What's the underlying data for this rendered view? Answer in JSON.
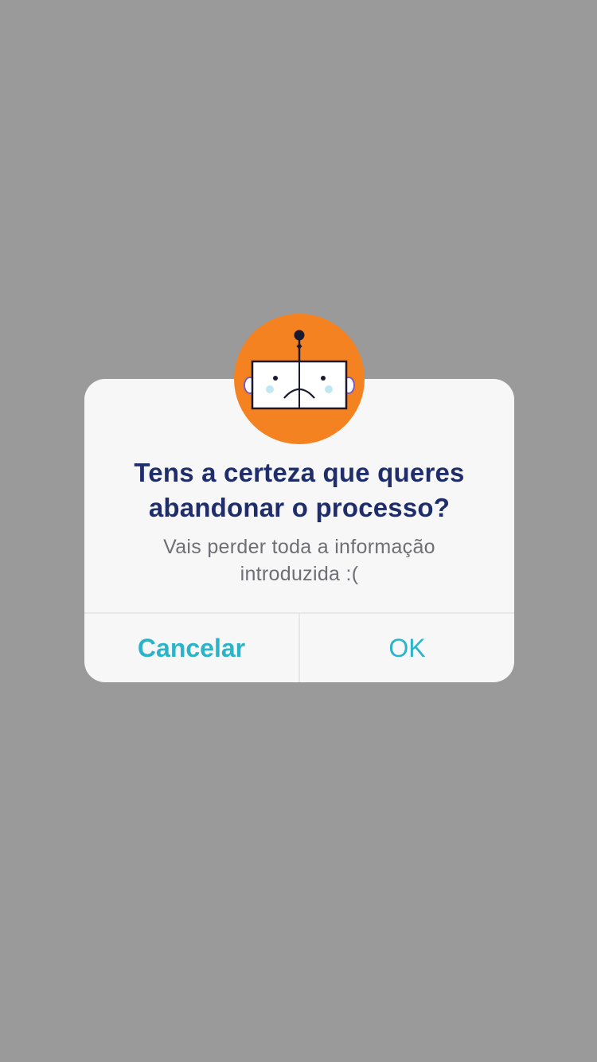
{
  "dialog": {
    "icon": "sad-robot-icon",
    "title_line1": "Tens a certeza que queres",
    "title_line2": "abandonar o processo?",
    "message_line1": "Vais perder toda a informação",
    "message_line2": "introduzida :(",
    "cancel_label": "Cancelar",
    "ok_label": "OK"
  },
  "colors": {
    "backdrop": "#9a9a9a",
    "dialog_background": "#f7f7f7",
    "title": "#1f2d6b",
    "message": "#6e6e76",
    "button_text": "#2bb4c9",
    "mascot_orange": "#f58220"
  }
}
